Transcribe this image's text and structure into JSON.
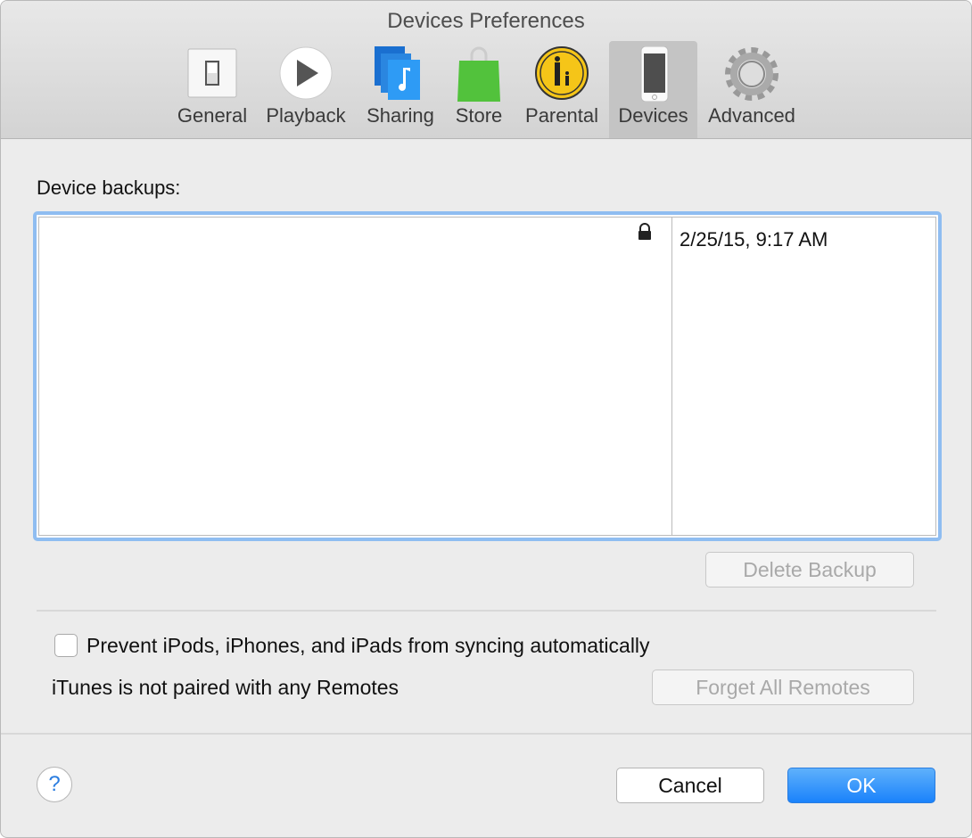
{
  "window": {
    "title": "Devices Preferences"
  },
  "tabs": [
    {
      "label": "General"
    },
    {
      "label": "Playback"
    },
    {
      "label": "Sharing"
    },
    {
      "label": "Store"
    },
    {
      "label": "Parental"
    },
    {
      "label": "Devices"
    },
    {
      "label": "Advanced"
    }
  ],
  "selected_tab": "Devices",
  "backups": {
    "label": "Device backups:",
    "rows": [
      {
        "name": "",
        "locked": true,
        "date": "2/25/15, 9:17 AM"
      }
    ],
    "delete_label": "Delete Backup"
  },
  "prevent_sync": {
    "label": "Prevent iPods, iPhones, and iPads from syncing automatically",
    "checked": false
  },
  "remotes": {
    "status": "iTunes is not paired with any Remotes",
    "forget_label": "Forget All Remotes"
  },
  "footer": {
    "help": "?",
    "cancel": "Cancel",
    "ok": "OK"
  }
}
